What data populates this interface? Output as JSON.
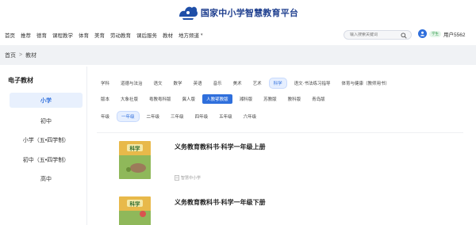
{
  "site": {
    "title": "国家中小学智慧教育平台"
  },
  "nav": {
    "items": [
      "首页",
      "推荐",
      "德育",
      "课程教学",
      "体育",
      "美育",
      "劳动教育",
      "课后服务",
      "教材",
      "地方频道"
    ],
    "search_placeholder": "输入搜索关键词",
    "role_badge": "学生",
    "username": "用户5562"
  },
  "breadcrumb": {
    "home": "首页",
    "sep": ">",
    "current": "教材"
  },
  "sidebar": {
    "title": "电子教材",
    "items": [
      {
        "label": "小学",
        "active": true
      },
      {
        "label": "初中",
        "active": false
      },
      {
        "label": "小学（五•四学制）",
        "active": false
      },
      {
        "label": "初中（五•四学制）",
        "active": false
      },
      {
        "label": "高中",
        "active": false
      }
    ]
  },
  "filters": {
    "subjects": [
      "学科",
      "道德与法治",
      "语文",
      "数学",
      "英语",
      "音乐",
      "美术",
      "艺术",
      "科学",
      "语文·书法练习指导",
      "体育与健康（教师用书）"
    ],
    "selected_subject": "科学",
    "versions": [
      "版本",
      "大象社版",
      "粤教粤科版",
      "冀人版",
      "人教鄂教版",
      "湘科版",
      "苏教版",
      "教科版",
      "青岛版"
    ],
    "selected_version": "人教鄂教版",
    "grades": [
      "年级",
      "一年级",
      "二年级",
      "三年级",
      "四年级",
      "五年级",
      "六年级"
    ],
    "selected_grade": "一年级"
  },
  "books": [
    {
      "title": "义务教育教科书·科学一年级上册",
      "source": "智慧中小学",
      "cover_text": "科学"
    },
    {
      "title": "义务教育教科书·科学一年级下册",
      "cover_text": "科学"
    }
  ],
  "colors": {
    "accent": "#2f6fdc",
    "brand": "#1f3f8f",
    "crumb_bg": "#f0f2f5"
  }
}
